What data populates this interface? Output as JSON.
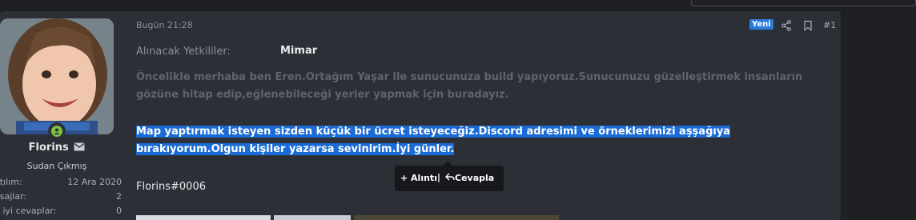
{
  "user": {
    "name": "Florins",
    "title": "Sudan Çıkmış",
    "stats": [
      {
        "label": "atılım:",
        "value": "12 Ara 2020"
      },
      {
        "label": "esajlar:",
        "value": "2"
      },
      {
        "label": "n iyi cevaplar:",
        "value": "0"
      }
    ]
  },
  "post": {
    "date": "Bugün 21:28",
    "new_badge": "Yeni",
    "number": "#1",
    "field_label": "Alınacak Yetkililer:",
    "field_value": "Mimar",
    "paragraph_1": "Öncelikle merhaba ben Eren.Ortağım Yaşar ile sunucunuza build yapıyoruz.Sunucunuzu güzelleştirmek insanların gözüne hitap edip,eğlenebileceği yerler yapmak için buradayız.",
    "paragraph_2_line_1": "Map yaptırmak isteyen sizden küçük bir ücret isteyeceğiz.Discord adresimi ve örneklerimizi aşşağıya",
    "paragraph_2_line_2": "bırakıyorum.Olgun kişiler yazarsa sevinirim.İyi günler.",
    "signature": "Florins#0006"
  },
  "tooltip": {
    "quote_label": "+ Alıntı",
    "separator": "|",
    "reply_label": "Cevapla"
  },
  "colors": {
    "background": "#1e2024",
    "post_bg": "#2c2f36",
    "accent": "#2a7bd9",
    "selection": "#1a6bd6",
    "online": "#7ac143"
  }
}
